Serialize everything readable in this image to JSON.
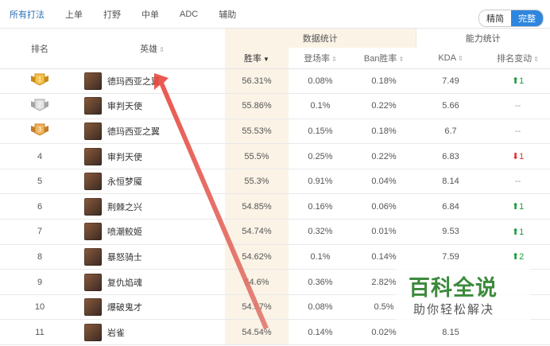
{
  "roles": [
    "所有打法",
    "上单",
    "打野",
    "中单",
    "ADC",
    "辅助"
  ],
  "view_toggle": {
    "simple": "精简",
    "full": "完整"
  },
  "groups": {
    "stats": "数据统计",
    "ability": "能力统计"
  },
  "headers": {
    "rank": "排名",
    "hero": "英雄",
    "win": "胜率",
    "pick": "登场率",
    "ban": "Ban胜率",
    "kda": "KDA",
    "change": "排名变动"
  },
  "rows": [
    {
      "rank": "1",
      "medal": "gold",
      "name": "德玛西亚之翼",
      "win": "56.31%",
      "pick": "0.08%",
      "ban": "0.18%",
      "kda": "7.49",
      "change": "1",
      "dir": "up"
    },
    {
      "rank": "2",
      "medal": "silver",
      "name": "审判天使",
      "win": "55.86%",
      "pick": "0.1%",
      "ban": "0.22%",
      "kda": "5.66",
      "change": "--",
      "dir": "none"
    },
    {
      "rank": "3",
      "medal": "bronze",
      "name": "德玛西亚之翼",
      "win": "55.53%",
      "pick": "0.15%",
      "ban": "0.18%",
      "kda": "6.7",
      "change": "--",
      "dir": "none"
    },
    {
      "rank": "4",
      "medal": "",
      "name": "审判天使",
      "win": "55.5%",
      "pick": "0.25%",
      "ban": "0.22%",
      "kda": "6.83",
      "change": "1",
      "dir": "down"
    },
    {
      "rank": "5",
      "medal": "",
      "name": "永恒梦魇",
      "win": "55.3%",
      "pick": "0.91%",
      "ban": "0.04%",
      "kda": "8.14",
      "change": "--",
      "dir": "none"
    },
    {
      "rank": "6",
      "medal": "",
      "name": "荆棘之兴",
      "win": "54.85%",
      "pick": "0.16%",
      "ban": "0.06%",
      "kda": "6.84",
      "change": "1",
      "dir": "up"
    },
    {
      "rank": "7",
      "medal": "",
      "name": "喷潮鲛姬",
      "win": "54.74%",
      "pick": "0.32%",
      "ban": "0.01%",
      "kda": "9.53",
      "change": "1",
      "dir": "up"
    },
    {
      "rank": "8",
      "medal": "",
      "name": "暴怒骑士",
      "win": "54.62%",
      "pick": "0.1%",
      "ban": "0.14%",
      "kda": "7.59",
      "change": "2",
      "dir": "up"
    },
    {
      "rank": "9",
      "medal": "",
      "name": "复仇焰魂",
      "win": "54.6%",
      "pick": "0.36%",
      "ban": "2.82%",
      "kda": "",
      "change": "",
      "dir": "none"
    },
    {
      "rank": "10",
      "medal": "",
      "name": "爆破鬼才",
      "win": "54.57%",
      "pick": "0.08%",
      "ban": "0.5%",
      "kda": "",
      "change": "",
      "dir": "none"
    },
    {
      "rank": "11",
      "medal": "",
      "name": "岩雀",
      "win": "54.54%",
      "pick": "0.14%",
      "ban": "0.02%",
      "kda": "8.15",
      "change": "",
      "dir": "none"
    }
  ],
  "watermark": {
    "title": "百科全说",
    "subtitle": "助你轻松解决"
  },
  "colors": {
    "accent": "#2e86de",
    "stats_bg": "#fbf3e6",
    "up": "#1a9b3a",
    "down": "#e03030",
    "annotation": "#e0413a"
  },
  "annotation": "red-arrow-pointing-to-hero-column"
}
